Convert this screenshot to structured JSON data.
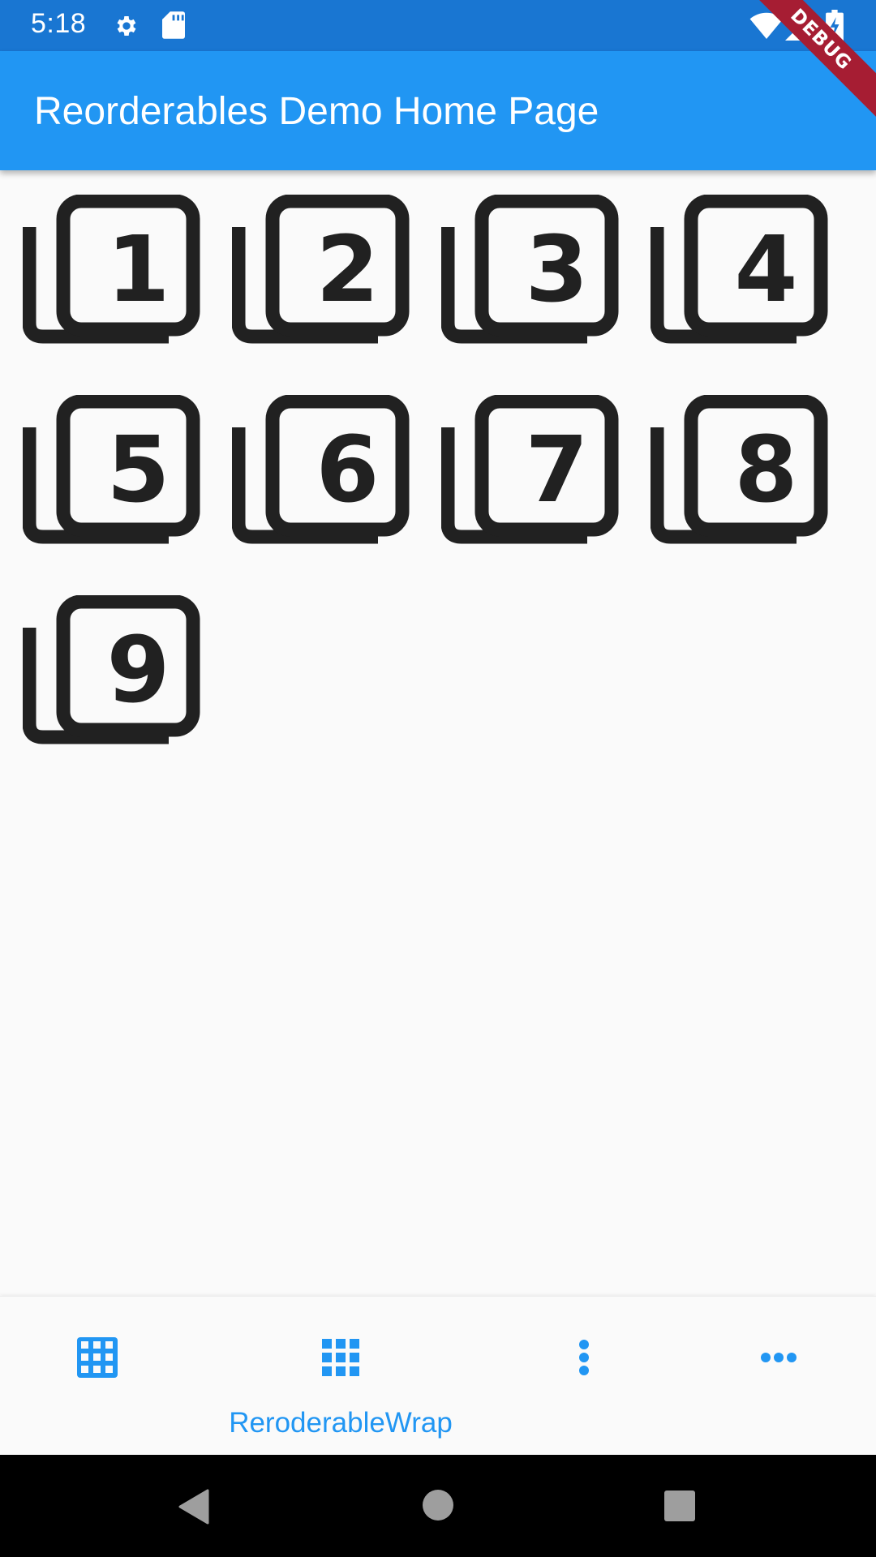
{
  "status_bar": {
    "time": "5:18",
    "icons": [
      "gear-icon",
      "sd-card-icon",
      "wifi-icon",
      "signal-icon",
      "battery-charging-icon"
    ]
  },
  "app_bar": {
    "title": "Reorderables Demo Home Page"
  },
  "debug_banner": "DEBUG",
  "tiles": [
    "1",
    "2",
    "3",
    "4",
    "5",
    "6",
    "7",
    "8",
    "9"
  ],
  "bottom_nav": {
    "items": [
      {
        "icon": "table-grid-icon",
        "label": ""
      },
      {
        "icon": "apps-grid-icon",
        "label": "ReroderableWrap",
        "selected": true
      },
      {
        "icon": "more-vert-icon",
        "label": ""
      },
      {
        "icon": "more-horiz-icon",
        "label": ""
      }
    ]
  },
  "system_nav": {
    "icons": [
      "back-icon",
      "home-icon",
      "recents-icon"
    ]
  },
  "colors": {
    "primary": "#2196f3",
    "primary_dark": "#1976d2",
    "icon": "#212121",
    "background": "#fafafa",
    "debug": "#a61d33"
  }
}
